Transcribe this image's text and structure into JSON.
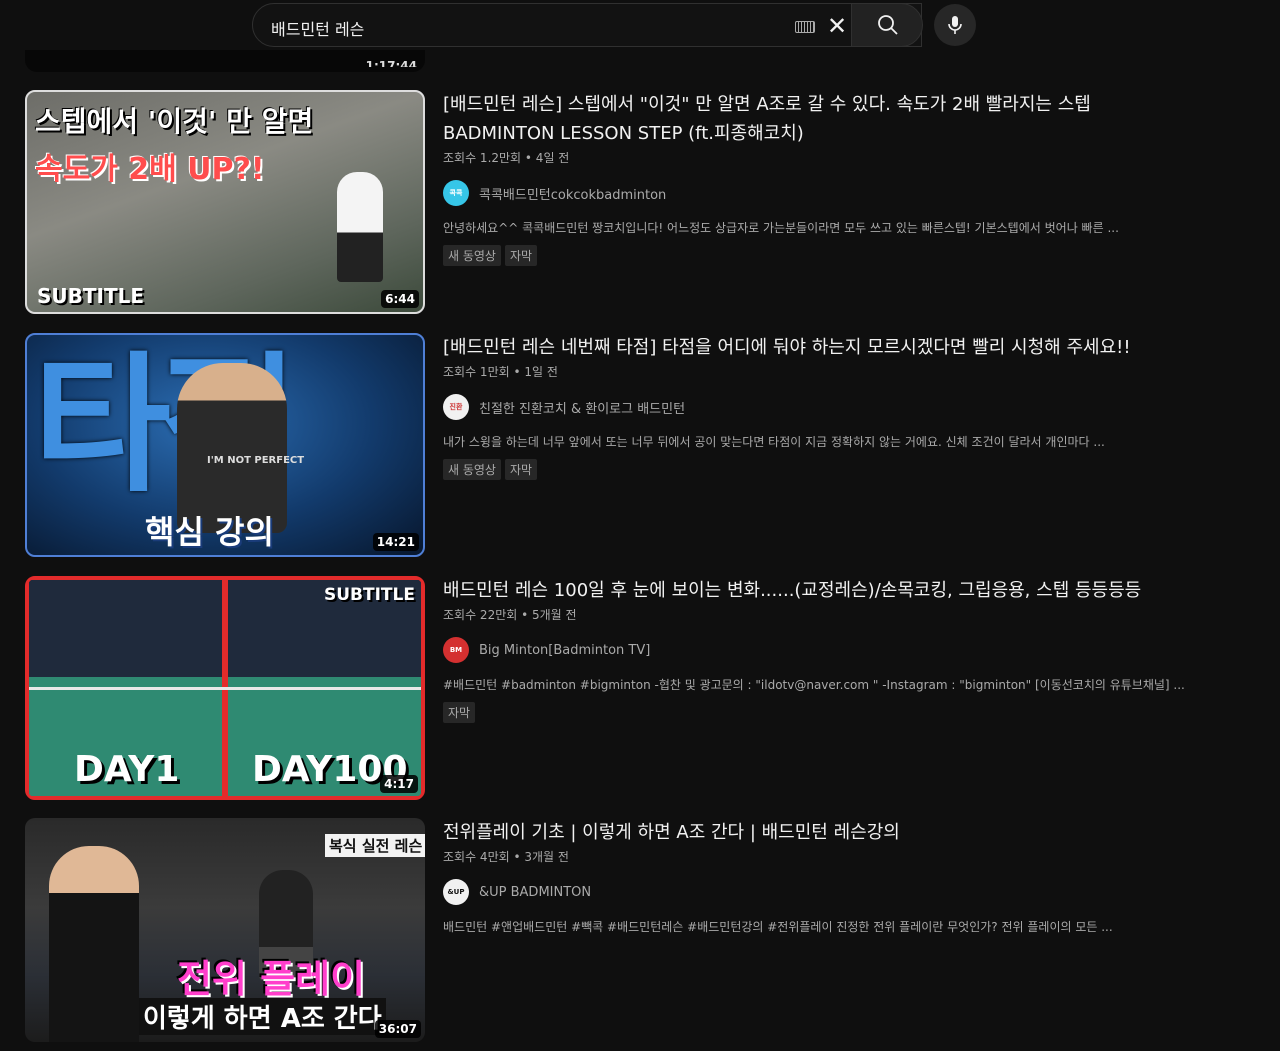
{
  "search": {
    "query": "배드민턴 레슨"
  },
  "icons": {
    "keyboard": "keyboard-icon",
    "clear": "✕",
    "search": "search-icon",
    "mic": "mic-icon"
  },
  "previous": {
    "duration": "1:17:44"
  },
  "results": [
    {
      "title_line1": "[배드민턴 레슨] 스텝에서 \"이것\" 만 알면 A조로 갈 수 있다. 속도가 2배 빨라지는 스텝",
      "title_line2": "BADMINTON LESSON STEP (ft.피종해코치)",
      "meta": "조회수 1.2만회 • 4일 전",
      "channel": "콕콕배드민턴cokcokbadminton",
      "avatar_text": "콕콕",
      "description": "안녕하세요^^ 콕콕배드민턴 짱코치입니다! 어느정도 상급자로 가는분들이라면 모두 쓰고 있는 빠른스텝! 기본스텝에서 벗어나 빠른 ...",
      "badges": [
        "새 동영상",
        "자막"
      ],
      "duration": "6:44",
      "thumb_text1": "스텝에서 '이것' 만 알면",
      "thumb_text2": "속도가 2배 UP?!",
      "thumb_text3": "SUBTITLE"
    },
    {
      "title_line1": "[배드민턴 레슨 네번째 타점] 타점을 어디에 둬야 하는지 모르시겠다면 빨리 시청해 주세요!!",
      "meta": "조회수 1만회 • 1일 전",
      "channel": "친절한 진환코치 & 환이로그 배드민턴",
      "avatar_text": "진환",
      "description": "내가 스윙을 하는데 너무 앞에서 또는 너무 뒤에서 공이 맞는다면 타점이 지금 정확하지 않는 거에요. 신체 조건이 달라서 개인마다 ...",
      "badges": [
        "새 동영상",
        "자막"
      ],
      "duration": "14:21",
      "thumb_text1": "타점",
      "thumb_text2": "핵심 강의",
      "thumb_text3": "I'M NOT PERFECT"
    },
    {
      "title_line1": "배드민턴 레슨 100일 후 눈에 보이는 변화......(교정레슨)/손목코킹, 그립응용, 스텝 등등등등",
      "meta": "조회수 22만회 • 5개월 전",
      "channel": "Big Minton[Badminton TV]",
      "avatar_text": "BM",
      "description": "#배드민턴 #badminton #bigminton -협찬 및 광고문의 : \"ildotv@naver.com \" -Instagram : \"bigminton\" [이동선코치의 유튜브채널] ...",
      "badges": [
        "자막"
      ],
      "duration": "4:17",
      "thumb_text1": "DAY1",
      "thumb_text2": "DAY100",
      "thumb_text3": "SUBTITLE"
    },
    {
      "title_line1": "전위플레이 기초 | 이렇게 하면 A조 간다 | 배드민턴 레슨강의",
      "meta": "조회수 4만회 • 3개월 전",
      "channel": "&UP BADMINTON",
      "avatar_text": "&UP",
      "description": "배드민턴 #앤업배드민턴 #빽콕 #배드민턴레슨 #배드민턴강의 #전위플레이 진정한 전위 플레이란 무엇인가? 전위 플레이의 모든 ...",
      "badges": [],
      "duration": "36:07",
      "thumb_text1": "복식 실전 레슨",
      "thumb_text2": "전위 플레이",
      "thumb_text3": "이렇게 하면 A조 간다"
    }
  ]
}
